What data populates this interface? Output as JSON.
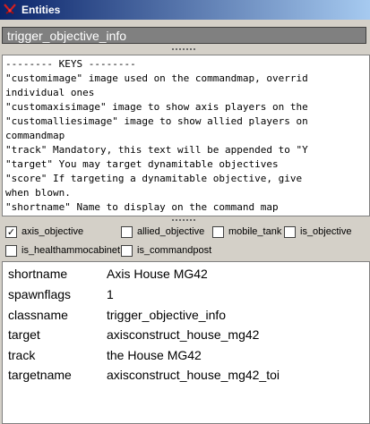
{
  "window": {
    "title": "Entities",
    "icon": "swords-icon"
  },
  "classname_field": {
    "value": "trigger_objective_info"
  },
  "keys": {
    "lines": [
      "-------- KEYS --------",
      "\"customimage\" image used on the commandmap, overrid",
      "individual ones",
      "\"customaxisimage\" image to show axis players on the",
      "\"customalliesimage\" image to show allied players on",
      "commandmap",
      "\"track\" Mandatory, this text will be appended to \"Y",
      "\"target\" You may target dynamitable objectives",
      "\"score\" If targeting a dynamitable objective, give",
      "when blown.",
      "\"shortname\" Name to display on the command map"
    ]
  },
  "spawnflags": [
    {
      "label": "axis_objective",
      "checked": true
    },
    {
      "label": "allied_objective",
      "checked": false
    },
    {
      "label": "mobile_tank",
      "checked": false
    },
    {
      "label": "is_objective",
      "checked": false
    },
    {
      "label": "is_healthammocabinet",
      "checked": false
    },
    {
      "label": "is_commandpost",
      "checked": false
    }
  ],
  "properties": [
    {
      "key": "shortname",
      "value": "Axis House MG42"
    },
    {
      "key": "spawnflags",
      "value": "1"
    },
    {
      "key": "classname",
      "value": "trigger_objective_info"
    },
    {
      "key": "target",
      "value": "axisconstruct_house_mg42"
    },
    {
      "key": "track",
      "value": "the House MG42"
    },
    {
      "key": "targetname",
      "value": "axisconstruct_house_mg42_toi"
    }
  ],
  "colors": {
    "titlebar_start": "#0a246a",
    "titlebar_end": "#a6caf0",
    "window_bg": "#d4d0c8",
    "field_bg": "#808080"
  }
}
